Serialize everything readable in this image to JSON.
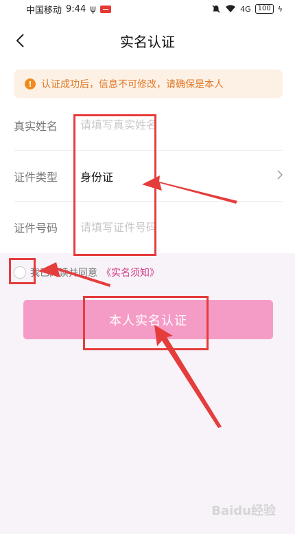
{
  "status_bar": {
    "carrier": "中国移动",
    "time": "9:44",
    "battery": "100",
    "network": "4G"
  },
  "header": {
    "title": "实名认证"
  },
  "notice": {
    "text": "认证成功后，信息不可修改，请确保是本人",
    "icon": "info-icon"
  },
  "form": {
    "name_label": "真实姓名",
    "name_placeholder": "请填写真实姓名",
    "type_label": "证件类型",
    "type_value": "身份证",
    "number_label": "证件号码",
    "number_placeholder": "请填写证件号码"
  },
  "agreement": {
    "text": "我已阅读并同意",
    "link": "《实名须知》"
  },
  "submit_label": "本人实名认证",
  "watermark": "Baidu经验",
  "colors": {
    "accent": "#f59cc6",
    "link": "#d23c8a",
    "notice_text": "#e07a2a",
    "annotation": "#e53c3c"
  }
}
